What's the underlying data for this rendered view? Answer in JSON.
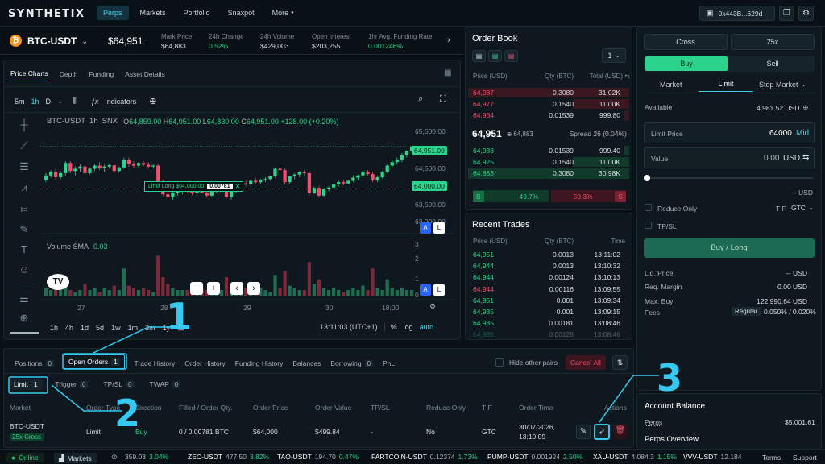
{
  "header": {
    "logo": "SYNTHETIX",
    "nav": [
      "Perps",
      "Markets",
      "Portfolio",
      "Snaxpot",
      "More"
    ],
    "wallet": "0x443B...629d"
  },
  "market": {
    "symbol": "BTC-USDT",
    "price": "$64,951",
    "stats": [
      {
        "label": "Mark Price",
        "value": "$64,883"
      },
      {
        "label": "24h Change",
        "value": "0.52%"
      },
      {
        "label": "24h Volume",
        "value": "$429,003"
      },
      {
        "label": "Open Interest",
        "value": "$203,255"
      },
      {
        "label": "1hr Avg. Funding Rate",
        "value": "0.001246%"
      }
    ]
  },
  "chart": {
    "tabs": [
      "Price Charts",
      "Depth",
      "Funding",
      "Asset Details"
    ],
    "intervals": [
      "5m",
      "1h",
      "D"
    ],
    "indicators": "Indicators",
    "legend_symbol": "BTC-USDT",
    "legend_tf": "1h",
    "legend_ex": "SNX",
    "ohlc": {
      "o": "64,859.00",
      "h": "64,951.00",
      "l": "64,830.00",
      "c": "64,951.00",
      "chg": "+128.00 (+0.20%)"
    },
    "volume_label": "Volume SMA",
    "volume_value": "0.03",
    "limit_tag": "Limit Long $64,000.00",
    "limit_qty": "0.00781",
    "price_ticks": [
      "65,500.00",
      "65,000.00",
      "64,500.00",
      "64,000.00",
      "63,500.00",
      "63,000.00"
    ],
    "last_price": "64,951.00",
    "limit_price": "64,000.00",
    "vol_ticks": [
      "3",
      "2",
      "1",
      "0"
    ],
    "x_ticks": [
      "27",
      "28",
      "29",
      "30",
      "18:00"
    ],
    "ranges": [
      "1h",
      "4h",
      "1d",
      "5d",
      "1w",
      "1m",
      "3m",
      "1y"
    ],
    "time": "13:11:03 (UTC+1)",
    "pct": "%",
    "log": "log",
    "auto": "auto",
    "candles": [
      [
        64200,
        64350,
        64150,
        64300
      ],
      [
        64300,
        64420,
        64250,
        64380
      ],
      [
        64380,
        64450,
        64200,
        64260
      ],
      [
        64260,
        64400,
        64220,
        64350
      ],
      [
        64350,
        64620,
        64300,
        64580
      ],
      [
        64580,
        64620,
        64350,
        64400
      ],
      [
        64400,
        64500,
        64300,
        64450
      ],
      [
        64450,
        64550,
        64380,
        64500
      ],
      [
        64500,
        64520,
        64300,
        64350
      ],
      [
        64350,
        64480,
        64320,
        64450
      ],
      [
        64450,
        64560,
        64400,
        64520
      ],
      [
        64520,
        64600,
        64420,
        64460
      ],
      [
        64460,
        64540,
        64380,
        64500
      ],
      [
        64500,
        64560,
        64450,
        64530
      ],
      [
        64530,
        64580,
        64350,
        64400
      ],
      [
        64400,
        64500,
        64360,
        64480
      ],
      [
        64480,
        64700,
        64450,
        64650
      ],
      [
        64650,
        64700,
        64500,
        64560
      ],
      [
        64560,
        64620,
        64480,
        64520
      ],
      [
        64520,
        64600,
        64480,
        64580
      ],
      [
        64580,
        64620,
        64500,
        64540
      ],
      [
        64540,
        64600,
        64460,
        64500
      ],
      [
        64500,
        64560,
        64460,
        64520
      ],
      [
        64520,
        64560,
        64100,
        64150
      ],
      [
        64150,
        64200,
        63850,
        63880
      ],
      [
        63880,
        64000,
        63780,
        63820
      ],
      [
        63820,
        63950,
        63760,
        63900
      ],
      [
        63900,
        63980,
        63850,
        63950
      ],
      [
        63950,
        64050,
        63880,
        64000
      ],
      [
        64000,
        64100,
        63900,
        63950
      ],
      [
        63950,
        64020,
        63860,
        63900
      ],
      [
        63900,
        64000,
        63850,
        63980
      ],
      [
        63980,
        64060,
        63900,
        63920
      ],
      [
        63920,
        63960,
        63800,
        63850
      ],
      [
        63850,
        64000,
        63820,
        63970
      ],
      [
        63970,
        64100,
        63900,
        64060
      ],
      [
        64060,
        64120,
        64000,
        64080
      ],
      [
        64080,
        64120,
        63780,
        63820
      ],
      [
        63820,
        63980,
        63760,
        63950
      ],
      [
        63950,
        64080,
        63900,
        64050
      ],
      [
        64050,
        64150,
        64000,
        64120
      ],
      [
        64120,
        64180,
        64060,
        64100
      ],
      [
        64100,
        64200,
        64050,
        64180
      ],
      [
        64180,
        64230,
        64120,
        64150
      ],
      [
        64150,
        64230,
        64100,
        64200
      ],
      [
        64200,
        64260,
        64150,
        64220
      ],
      [
        64220,
        64300,
        64180,
        64280
      ],
      [
        64280,
        64480,
        64250,
        64450
      ],
      [
        64450,
        64500,
        64380,
        64420
      ],
      [
        64420,
        64480,
        64100,
        64150
      ],
      [
        64150,
        64300,
        64120,
        64280
      ],
      [
        64280,
        64350,
        64220,
        64320
      ],
      [
        64320,
        64400,
        64260,
        64380
      ],
      [
        64380,
        64420,
        64300,
        64350
      ],
      [
        64350,
        64380,
        63850,
        63900
      ],
      [
        63900,
        64050,
        63880,
        64020
      ],
      [
        64020,
        64060,
        63820,
        63850
      ],
      [
        63850,
        64020,
        63830,
        64000
      ],
      [
        64000,
        64060,
        63950,
        64030
      ],
      [
        64030,
        64120,
        63980,
        64100
      ],
      [
        64100,
        64180,
        64050,
        64150
      ],
      [
        64150,
        64200,
        64080,
        64120
      ],
      [
        64120,
        64200,
        64100,
        64180
      ],
      [
        64180,
        64300,
        64150,
        64250
      ],
      [
        64250,
        64320,
        64200,
        64300
      ],
      [
        64300,
        64420,
        64250,
        64380
      ],
      [
        64380,
        64420,
        64300,
        64330
      ],
      [
        64330,
        64380,
        64150,
        64200
      ],
      [
        64200,
        64300,
        64150,
        64260
      ],
      [
        64260,
        64400,
        64230,
        64380
      ],
      [
        64380,
        64550,
        64350,
        64520
      ],
      [
        64520,
        64650,
        64480,
        64600
      ],
      [
        64600,
        64700,
        64550,
        64650
      ],
      [
        64650,
        64800,
        64600,
        64760
      ],
      [
        64760,
        64860,
        64700,
        64850
      ],
      [
        64850,
        64951,
        64830,
        64951
      ]
    ],
    "volumes": [
      0.4,
      0.3,
      0.5,
      0.3,
      0.9,
      0.3,
      0.2,
      0.3,
      0.6,
      0.3,
      0.4,
      0.2,
      0.4,
      0.3,
      0.5,
      0.3,
      1.3,
      0.5,
      0.4,
      0.3,
      0.4,
      0.3,
      0.2,
      1.9,
      0.9,
      0.6,
      0.4,
      0.3,
      0.3,
      0.3,
      0.4,
      0.3,
      0.4,
      0.3,
      0.5,
      0.4,
      0.3,
      0.9,
      0.5,
      0.4,
      0.3,
      0.4,
      0.3,
      0.3,
      0.4,
      0.3,
      0.2,
      1.0,
      0.4,
      1.2,
      0.5,
      0.4,
      0.3,
      0.3,
      1.6,
      0.6,
      0.8,
      0.4,
      0.3,
      0.4,
      0.3,
      0.2,
      0.3,
      0.4,
      0.3,
      0.5,
      0.3,
      1.3,
      0.4,
      0.3,
      0.8,
      0.4,
      0.3,
      0.4,
      0.3,
      0.3
    ]
  },
  "orderbook": {
    "title": "Order Book",
    "step": "1",
    "headers": [
      "Price (USD)",
      "Qty (BTC)",
      "Total (USD)"
    ],
    "asks": [
      {
        "p": "64,987",
        "q": "0.3080",
        "t": "31.02K",
        "w": 1.0
      },
      {
        "p": "64,977",
        "q": "0.1540",
        "t": "11.00K",
        "w": 0.35
      },
      {
        "p": "64,964",
        "q": "0.01539",
        "t": "999.80",
        "w": 0.03
      }
    ],
    "mid_price": "64,951",
    "mid_mark": "64,883",
    "spread": "Spread 26 (0.04%)",
    "bids": [
      {
        "p": "64,938",
        "q": "0.01539",
        "t": "999.40",
        "w": 0.03
      },
      {
        "p": "64,925",
        "q": "0.1540",
        "t": "11.00K",
        "w": 0.35
      },
      {
        "p": "64,883",
        "q": "0.3080",
        "t": "30.98K",
        "w": 1.0
      }
    ],
    "buy_label": "B",
    "buy_pct": "49.7%",
    "sell_pct": "50.3%",
    "sell_label": "S"
  },
  "trades": {
    "title": "Recent Trades",
    "headers": [
      "Price (USD)",
      "Qty (BTC)",
      "Time"
    ],
    "rows": [
      {
        "p": "64,951",
        "q": "0.0013",
        "t": "13:11:02",
        "s": "b"
      },
      {
        "p": "64,944",
        "q": "0.0013",
        "t": "13:10:32",
        "s": "b"
      },
      {
        "p": "64,944",
        "q": "0.00124",
        "t": "13:10:13",
        "s": "b"
      },
      {
        "p": "64,944",
        "q": "0.00116",
        "t": "13:09:55",
        "s": "s"
      },
      {
        "p": "64,951",
        "q": "0.001",
        "t": "13:09:34",
        "s": "b"
      },
      {
        "p": "64,935",
        "q": "0.001",
        "t": "13:09:15",
        "s": "b"
      },
      {
        "p": "64,935",
        "q": "0.00181",
        "t": "13:08:46",
        "s": "b"
      },
      {
        "p": "64,935",
        "q": "0.00128",
        "t": "13:08:46",
        "s": "b"
      }
    ]
  },
  "order_form": {
    "margin_mode": "Cross",
    "leverage": "25x",
    "buy": "Buy",
    "sell": "Sell",
    "types": [
      "Market",
      "Limit",
      "Stop Market"
    ],
    "available_label": "Available",
    "available_value": "4,981.52 USD",
    "limit_price_label": "Limit Price",
    "limit_price_value": "64000",
    "mid": "Mid",
    "value_label": "Value",
    "value_value": "0.00",
    "value_unit": "USD",
    "slider_value": "-- USD",
    "reduce_only": "Reduce Only",
    "tif_label": "TIF",
    "tif_value": "GTC",
    "tpsl": "TP/SL",
    "submit": "Buy / Long",
    "info": [
      {
        "label": "Liq. Price",
        "value": "-- USD"
      },
      {
        "label": "Req. Margin",
        "value": "0.00 USD"
      },
      {
        "label": "Max. Buy",
        "value": "122,990.64 USD"
      }
    ],
    "fees_label": "Fees",
    "fees_badge": "Regular",
    "fees_value": "0.050% / 0.020%"
  },
  "account": {
    "title": "Account Balance",
    "perps_label": "Perps",
    "perps_value": "$5,001.61",
    "overview": "Perps Overview"
  },
  "bottom": {
    "tabs": [
      {
        "label": "Positions",
        "count": "0"
      },
      {
        "label": "Open Orders",
        "count": "1"
      },
      {
        "label": "Trade History"
      },
      {
        "label": "Order History"
      },
      {
        "label": "Funding History"
      },
      {
        "label": "Balances"
      },
      {
        "label": "Borrowing",
        "count": "0"
      },
      {
        "label": "PnL"
      }
    ],
    "hide_pairs": "Hide other pairs",
    "cancel_all": "Cancel All",
    "subtabs": [
      {
        "label": "Limit",
        "count": "1"
      },
      {
        "label": "Trigger",
        "count": "0"
      },
      {
        "label": "TP/SL",
        "count": "0"
      },
      {
        "label": "TWAP",
        "count": "0"
      }
    ],
    "columns": [
      "Market",
      "Order Type",
      "Direction",
      "Filled / Order Qty.",
      "Order Price",
      "Order Value",
      "TP/SL",
      "Reduce Only",
      "TIF",
      "Order Time",
      "Actions"
    ],
    "order": {
      "market": "BTC-USDT",
      "margin": "25x Cross",
      "type": "Limit",
      "direction": "Buy",
      "filled": "0 / 0.00781 BTC",
      "price": "$64,000",
      "value": "$499.84",
      "tpsl": "-",
      "reduce": "No",
      "tif": "GTC",
      "time1": "30/07/2026,",
      "time2": "13:10:09"
    }
  },
  "footer": {
    "status": "Online",
    "markets": "Markets",
    "tickers": [
      {
        "name": "",
        "price": "359.03",
        "chg": "3.04%"
      },
      {
        "name": "ZEC-USDT",
        "price": "477.50",
        "chg": "3.82%"
      },
      {
        "name": "TAO-USDT",
        "price": "194.70",
        "chg": "0.47%"
      },
      {
        "name": "FARTCOIN-USDT",
        "price": "0.12374",
        "chg": "1.73%"
      },
      {
        "name": "PUMP-USDT",
        "price": "0.001924",
        "chg": "2.50%"
      },
      {
        "name": "XAU-USDT",
        "price": "4,084.3",
        "chg": "1.15%"
      },
      {
        "name": "VVV-USDT",
        "price": "12.184",
        "chg": ""
      }
    ],
    "terms": "Terms",
    "support": "Support"
  },
  "callouts": [
    "1",
    "2",
    "3"
  ],
  "colors": {
    "accent": "#3fd0e8",
    "green": "#2bd38c",
    "red": "#f0506e",
    "callout": "#35c8f0"
  }
}
